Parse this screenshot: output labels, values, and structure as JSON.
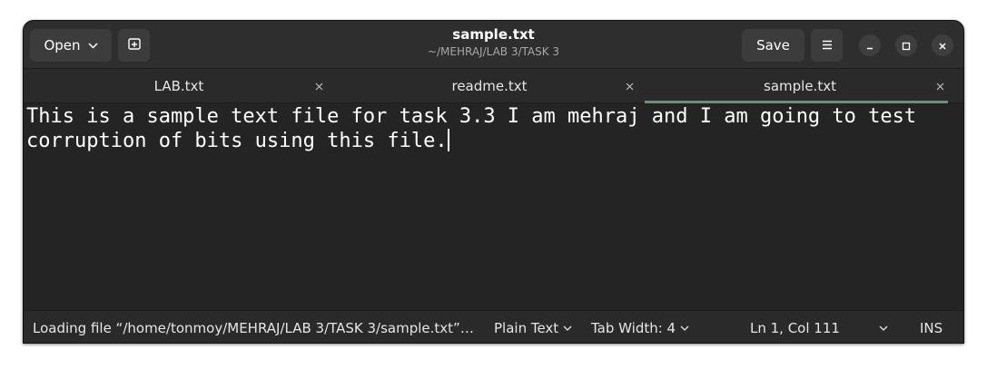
{
  "window": {
    "title": "sample.txt",
    "subtitle": "~/MEHRAJ/LAB 3/TASK 3"
  },
  "header": {
    "open_label": "Open",
    "save_label": "Save"
  },
  "tabs": [
    {
      "label": "LAB.txt",
      "active": false
    },
    {
      "label": "readme.txt",
      "active": false
    },
    {
      "label": "sample.txt",
      "active": true
    }
  ],
  "editor": {
    "content": "This is a sample text file for task 3.3 I am mehraj and I am going to test corruption of bits using this file."
  },
  "statusbar": {
    "loading": "Loading file “/home/tonmoy/MEHRAJ/LAB 3/TASK 3/sample.txt”…",
    "language": "Plain Text",
    "tab_width": "Tab Width: 4",
    "position": "Ln 1, Col 111",
    "mode": "INS"
  },
  "colors": {
    "window_bg": "#242424",
    "header_bg": "#2e2e2e",
    "accent_underline": "#6b8f76",
    "text": "#ffffff"
  },
  "icons": [
    "chevron-down-icon",
    "new-tab-icon",
    "hamburger-menu-icon",
    "minimize-icon",
    "maximize-icon",
    "close-icon",
    "tab-close-icon"
  ]
}
